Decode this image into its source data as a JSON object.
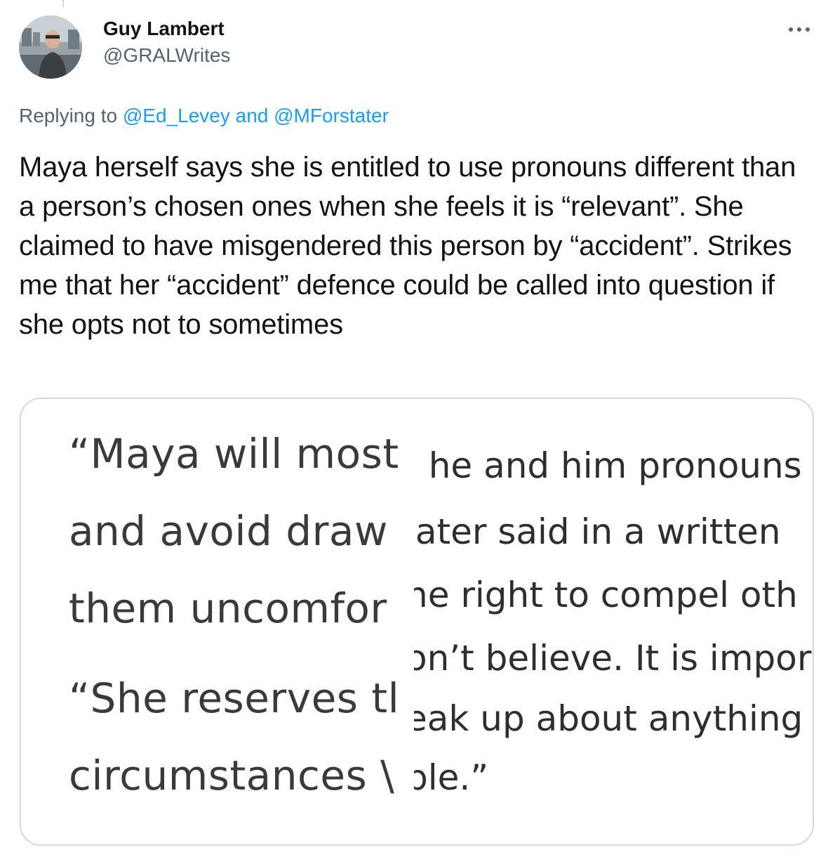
{
  "tweet": {
    "author": {
      "display_name": "Guy Lambert",
      "handle": "@GRALWrites"
    },
    "more_icon": "more-horizontal-icon",
    "replying": {
      "prefix": "Replying to",
      "mention_1": "@Ed_Levey",
      "conjunction": "and",
      "mention_2": "@MForstater"
    },
    "text": "Maya herself says she is entitled to use pronouns different than a person’s chosen ones when she feels it is “relevant”. She claimed to have misgendered this person by “accident”. Strikes me that her “accident” defence could be called into question if she opts not to sometimes"
  },
  "media": {
    "left_lines": [
      "“Maya will most",
      "and avoid draw",
      "them uncomfor",
      "“She reserves tl",
      "circumstances \\"
    ],
    "right_lines": [
      ": he and him pronouns",
      "iater said in a written",
      "he right to compel oth",
      "on’t believe. It is impor",
      "eak up about anything",
      "ble.”"
    ]
  },
  "colors": {
    "text": "#0f1419",
    "secondary": "#536471",
    "link": "#1d9bf0",
    "border": "#cfd9de"
  }
}
